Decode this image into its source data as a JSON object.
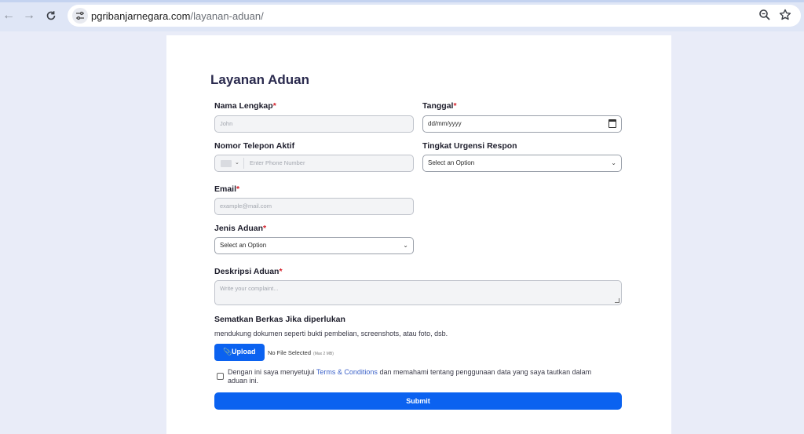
{
  "browser": {
    "url_host": "pgribanjarnegara.com",
    "url_path": "/layanan-aduan/"
  },
  "form": {
    "title": "Layanan Aduan",
    "nama": {
      "label": "Nama Lengkap",
      "required": "*",
      "placeholder": "John"
    },
    "tanggal": {
      "label": "Tanggal",
      "required": "*",
      "value": "dd/mm/yyyy"
    },
    "telepon": {
      "label": "Nomor Telepon Aktif",
      "placeholder": "Enter Phone Number"
    },
    "urgensi": {
      "label": "Tingkat Urgensi Respon",
      "value": "Select an Option"
    },
    "email": {
      "label": "Email",
      "required": "*",
      "placeholder": "example@mail.com"
    },
    "jenis": {
      "label": "Jenis Aduan",
      "required": "*",
      "value": "Select an Option"
    },
    "deskripsi": {
      "label": "Deskripsi Aduan",
      "required": "*",
      "placeholder": "Write your complaint..."
    },
    "berkas": {
      "label": "Sematkan Berkas Jika diperlukan",
      "helper": "mendukung dokumen seperti bukti pembelian, screenshots, atau foto, dsb.",
      "upload_label": "Upload",
      "no_file": "No File Selected",
      "max_size": "(Max 2 MB)"
    },
    "consent": {
      "text_before": "Dengan ini saya menyetujui ",
      "link": "Terms & Conditions",
      "text_after": " dan memahami tentang penggunaan data yang saya tautkan dalam aduan ini."
    },
    "submit_label": "Submit"
  },
  "colors": {
    "primary": "#0b62f0",
    "required": "#d4202a",
    "link": "#3d63c9"
  }
}
